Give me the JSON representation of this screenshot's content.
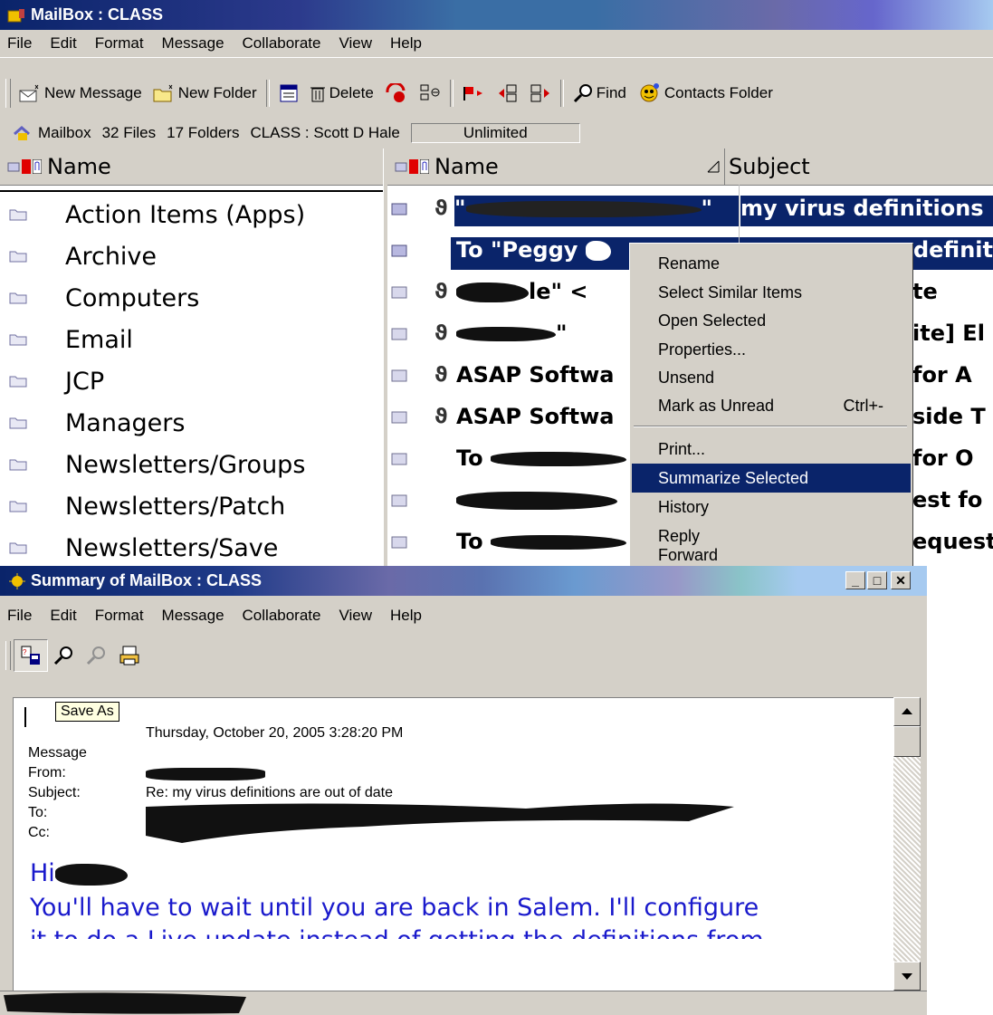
{
  "main_window": {
    "title": "MailBox : CLASS",
    "menu": [
      "File",
      "Edit",
      "Format",
      "Message",
      "Collaborate",
      "View",
      "Help"
    ],
    "toolbar": {
      "new_message": "New Message",
      "new_folder": "New Folder",
      "delete": "Delete",
      "find": "Find",
      "contacts_folder": "Contacts Folder"
    },
    "status": {
      "mailbox": "Mailbox",
      "files": "32 Files",
      "folders": "17 Folders",
      "user": "CLASS : Scott D Hale",
      "quota": "Unlimited"
    },
    "folder_pane": {
      "header": "Name",
      "folders": [
        "Action Items (Apps)",
        "Archive",
        "Computers",
        "Email",
        "JCP",
        "Managers",
        "Newsletters/Groups",
        "Newsletters/Patch",
        "Newsletters/Save"
      ]
    },
    "message_pane": {
      "name_header": "Name",
      "subject_header": "Subject",
      "rows": [
        {
          "name": "\"",
          "subject": "my virus definitions"
        },
        {
          "name": "To \"Peggy",
          "subject": "definit"
        },
        {
          "name": "le\" <",
          "subject": "te"
        },
        {
          "name": "\"",
          "subject": "ite] El"
        },
        {
          "name": "ASAP Softwa",
          "subject": "for A"
        },
        {
          "name": "ASAP Softwa",
          "subject": "side T"
        },
        {
          "name": "To",
          "subject": "for O"
        },
        {
          "name": "",
          "subject": "est fo"
        },
        {
          "name": "To",
          "subject": "equest"
        }
      ]
    },
    "context_menu": {
      "items": [
        "Rename",
        "Select Similar Items",
        "Open Selected",
        "Properties...",
        "Unsend",
        "Mark as Unread",
        "Print...",
        "Summarize Selected",
        "History",
        "Reply",
        "Forward"
      ],
      "mark_unread_shortcut": "Ctrl+-"
    }
  },
  "summary_window": {
    "title": "Summary of MailBox : CLASS",
    "menu": [
      "File",
      "Edit",
      "Format",
      "Message",
      "Collaborate",
      "View",
      "Help"
    ],
    "tooltip": "Save As",
    "date": "Thursday, October 20, 2005 3:28:20 PM",
    "labels": {
      "message": "Message",
      "from": "From:",
      "subject": "Subject:",
      "to": "To:",
      "cc": "Cc:"
    },
    "subject_value": "Re: my virus definitions are out of date",
    "body_line1": "Hi",
    "body_line2": "You'll have to wait until you are back in Salem.  I'll configure",
    "body_line3": "it to do a Live update instead of getting the definitions from"
  },
  "colors": {
    "selection": "#0a246a",
    "chrome": "#d4d0c8",
    "body_text": "#1a1acc",
    "flag": "#e00000"
  }
}
